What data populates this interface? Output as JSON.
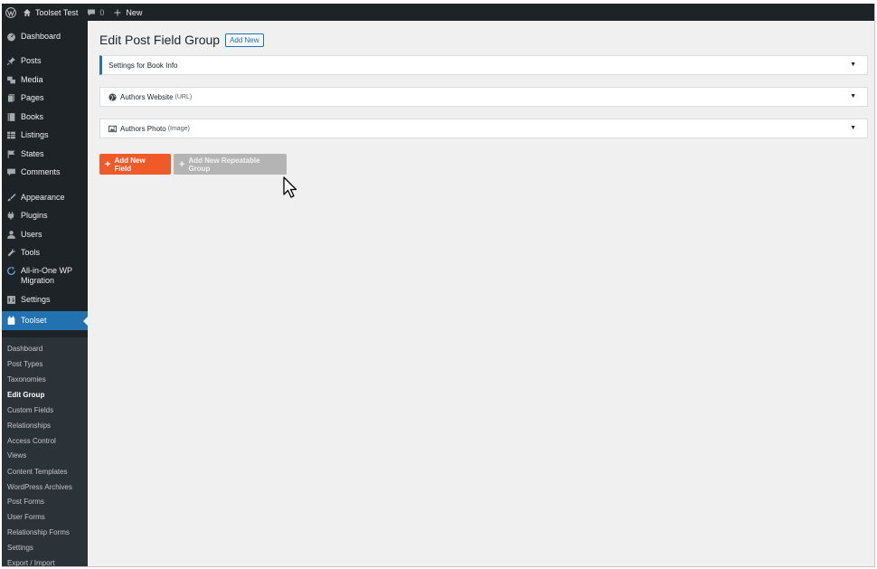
{
  "admin_bar": {
    "site_name": "Toolset Test",
    "comments_count": "0",
    "new_label": "New"
  },
  "sidebar": {
    "items": [
      {
        "label": "Dashboard",
        "icon": "dashboard-icon"
      },
      {
        "label": "Posts",
        "icon": "pin-icon"
      },
      {
        "label": "Media",
        "icon": "media-icon"
      },
      {
        "label": "Pages",
        "icon": "pages-icon"
      },
      {
        "label": "Books",
        "icon": "book-icon"
      },
      {
        "label": "Listings",
        "icon": "listings-icon"
      },
      {
        "label": "States",
        "icon": "flag-icon"
      },
      {
        "label": "Comments",
        "icon": "comment-icon"
      },
      {
        "label": "Appearance",
        "icon": "brush-icon"
      },
      {
        "label": "Plugins",
        "icon": "plugin-icon"
      },
      {
        "label": "Users",
        "icon": "user-icon"
      },
      {
        "label": "Tools",
        "icon": "wrench-icon"
      },
      {
        "label": "All-in-One WP",
        "label2": "Migration",
        "icon": "migration-icon"
      },
      {
        "label": "Settings",
        "icon": "settings-icon"
      },
      {
        "label": "Toolset",
        "icon": "toolset-icon"
      }
    ],
    "submenu": [
      "Dashboard",
      "Post Types",
      "Taxonomies",
      "Edit Group",
      "Custom Fields",
      "Relationships",
      "Access Control",
      "Views",
      "Content Templates",
      "WordPress Archives",
      "Post Forms",
      "User Forms",
      "Relationship Forms",
      "Settings",
      "Export / Import"
    ]
  },
  "main": {
    "title": "Edit Post Field Group",
    "add_new": "Add New",
    "panels": [
      {
        "label": "Settings for Book Info",
        "type": ""
      },
      {
        "label": "Authors Website",
        "type": "(URL)"
      },
      {
        "label": "Authors Photo",
        "type": "(Image)"
      }
    ],
    "add_field_label": "Add New Field",
    "add_group_label": "Add New Repeatable Group"
  }
}
